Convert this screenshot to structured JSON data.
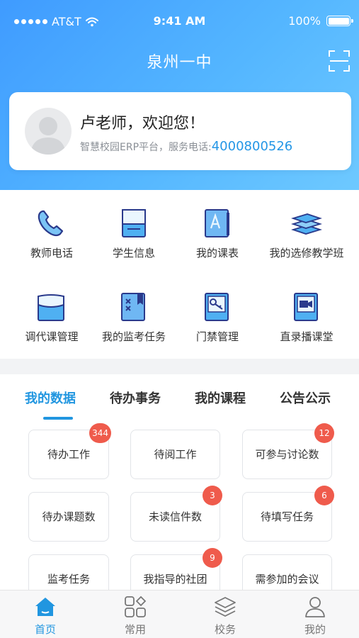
{
  "status_bar": {
    "carrier": "AT&T",
    "time": "9:41 AM",
    "battery": "100%"
  },
  "header": {
    "title": "泉州一中",
    "scan_icon": "scan-icon"
  },
  "profile": {
    "greeting": "卢老师，欢迎您！",
    "subtitle": "智慧校园ERP平台，服务电话:",
    "phone": "4000800526",
    "avatar_icon": "default-avatar-icon"
  },
  "menu": [
    {
      "label": "教师电话",
      "icon": "phone-icon"
    },
    {
      "label": "学生信息",
      "icon": "student-info-icon"
    },
    {
      "label": "我的课表",
      "icon": "timetable-icon"
    },
    {
      "label": "我的选修教学班",
      "icon": "elective-class-icon"
    },
    {
      "label": "调代课管理",
      "icon": "substitute-class-icon"
    },
    {
      "label": "我的监考任务",
      "icon": "exam-proctor-icon"
    },
    {
      "label": "门禁管理",
      "icon": "access-control-icon"
    },
    {
      "label": "直录播课堂",
      "icon": "live-class-icon"
    }
  ],
  "tabs": [
    {
      "label": "我的数据",
      "active": true
    },
    {
      "label": "待办事务",
      "active": false
    },
    {
      "label": "我的课程",
      "active": false
    },
    {
      "label": "公告公示",
      "active": false
    }
  ],
  "data_cards": [
    {
      "label": "待办工作",
      "badge": "344"
    },
    {
      "label": "待阅工作",
      "badge": ""
    },
    {
      "label": "可参与讨论数",
      "badge": "12"
    },
    {
      "label": "待办课题数",
      "badge": ""
    },
    {
      "label": "未读信件数",
      "badge": "3"
    },
    {
      "label": "待填写任务",
      "badge": "6"
    },
    {
      "label": "监考任务",
      "badge": ""
    },
    {
      "label": "我指导的社团",
      "badge": "9"
    },
    {
      "label": "需参加的会议",
      "badge": ""
    }
  ],
  "tabbar": [
    {
      "label": "首页",
      "icon": "home-icon",
      "active": true
    },
    {
      "label": "常用",
      "icon": "grid-icon",
      "active": false
    },
    {
      "label": "校务",
      "icon": "layers-icon",
      "active": false
    },
    {
      "label": "我的",
      "icon": "person-icon",
      "active": false
    }
  ],
  "colors": {
    "accent": "#2196e0",
    "badge": "#ef5b4c",
    "header_start": "#3f9bff",
    "header_end": "#6ec9ff"
  }
}
